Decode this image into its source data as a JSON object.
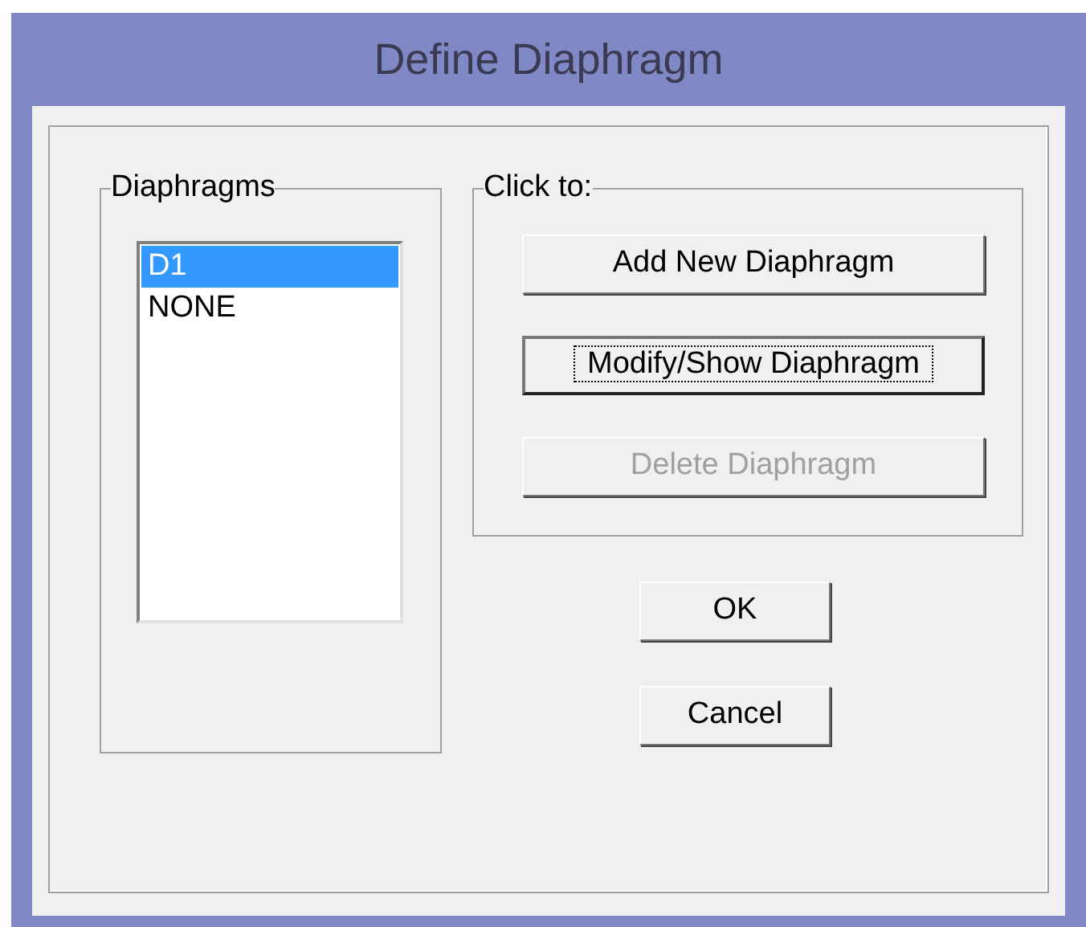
{
  "window": {
    "title": "Define Diaphragm"
  },
  "diaphragms": {
    "label": "Diaphragms",
    "items": [
      {
        "name": "D1",
        "selected": true
      },
      {
        "name": "NONE",
        "selected": false
      }
    ]
  },
  "actions": {
    "label": "Click to:",
    "buttons": [
      {
        "label": "Add New Diaphragm",
        "focused": false,
        "disabled": false
      },
      {
        "label": "Modify/Show Diaphragm",
        "focused": true,
        "disabled": false
      },
      {
        "label": "Delete Diaphragm",
        "focused": false,
        "disabled": true
      }
    ]
  },
  "buttons": [
    {
      "label": "OK"
    },
    {
      "label": "Cancel"
    }
  ]
}
